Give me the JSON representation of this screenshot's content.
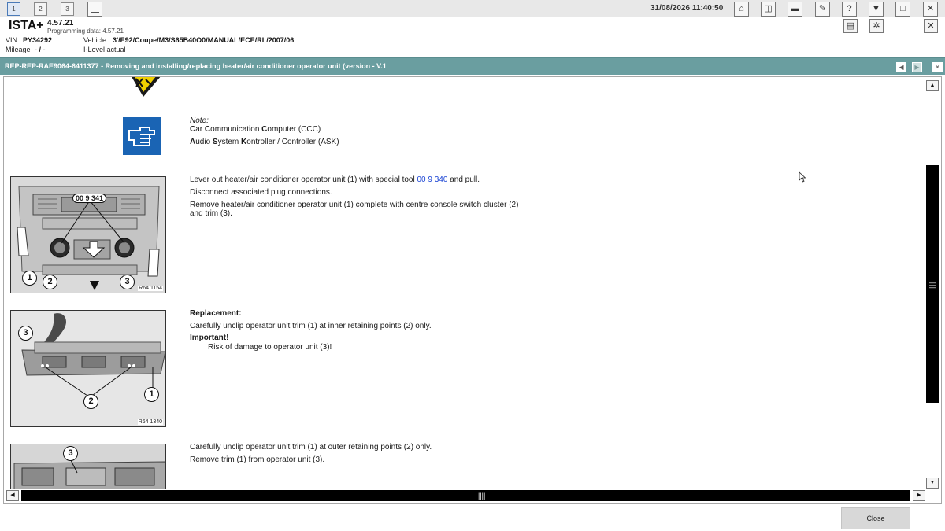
{
  "toolbar": {
    "tabs": [
      "1",
      "2",
      "3"
    ],
    "datetime": "31/08/2026 11:40:50",
    "icons": [
      "home-icon",
      "compare-icon",
      "vehicle-icon",
      "wrench-icon",
      "help-icon",
      "save-icon",
      "window-icon",
      "close-icon"
    ]
  },
  "header": {
    "app_name": "ISTA+",
    "version": "4.57.21",
    "programming_data": "Programming data:  4.57.21",
    "vin_label": "VIN",
    "vin_value": "PY34292",
    "vehicle_label": "Vehicle",
    "vehicle_value": "3'/E92/Coupe/M3/S65B40O0/MANUAL/ECE/RL/2007/06",
    "mileage_label": "Mileage",
    "mileage_value": "- / -",
    "ilevel_label": "I-Level actual"
  },
  "document": {
    "title": "REP-REP-RAE9064-6411377 - Removing and installing/replacing heater/air conditioner operator unit (version - V.1",
    "note_label": "Note:",
    "note_line1": [
      {
        "b": "C"
      },
      {
        "t": "ar "
      },
      {
        "b": "C"
      },
      {
        "t": "ommunication "
      },
      {
        "b": "C"
      },
      {
        "t": "omputer (CCC)"
      }
    ],
    "note_line2": [
      {
        "b": "A"
      },
      {
        "t": "udio "
      },
      {
        "b": "S"
      },
      {
        "t": "ystem "
      },
      {
        "b": "K"
      },
      {
        "t": "ontroller / Controller (ASK)"
      }
    ],
    "step1": {
      "line1_pre": "Lever out heater/air conditioner operator unit (1) with special tool ",
      "line1_link": "00 9 340",
      "line1_post": " and pull.",
      "line2": "Disconnect associated plug connections.",
      "line3": "Remove heater/air conditioner operator unit (1) complete with centre console switch cluster (2)",
      "line4": "and trim (3).",
      "figure_code": "R64 1154",
      "tool_label": "00 9 341",
      "callouts": [
        "1",
        "2",
        "3"
      ]
    },
    "step2": {
      "heading": "Replacement:",
      "line1": "Carefully unclip operator unit trim (1) at inner retaining points (2) only.",
      "important": "Important!",
      "line2": "Risk of damage to operator unit (3)!",
      "figure_code": "R64 1340",
      "callouts": [
        "3",
        "2",
        "1"
      ]
    },
    "step3": {
      "line1": "Carefully unclip operator unit trim (1) at outer retaining points (2) only.",
      "line2": "Remove trim (1) from operator unit (3).",
      "callouts": [
        "3"
      ]
    }
  },
  "footer": {
    "close_label": "Close"
  },
  "colors": {
    "titlebar": "#6a9ea0",
    "note_icon": "#1a64b4",
    "warning": "#f0d000",
    "link": "#1a44d4"
  }
}
